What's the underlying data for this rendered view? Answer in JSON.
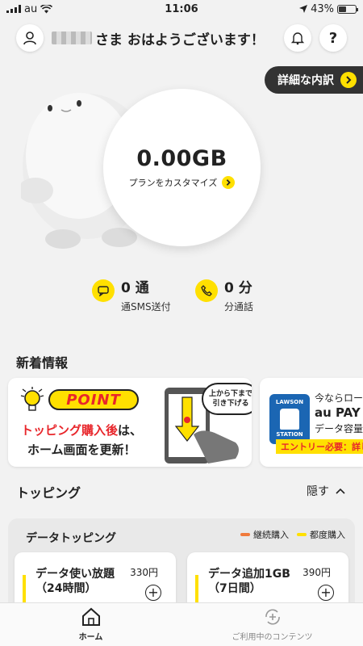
{
  "status_bar": {
    "carrier": "au",
    "time": "11:06",
    "battery": "43%"
  },
  "header": {
    "greeting": "さま おはようございます！",
    "icons": [
      "user-icon",
      "bell-icon",
      "help-icon"
    ],
    "help_label": "?"
  },
  "detail_button": {
    "label": "詳細な内訳"
  },
  "gauge": {
    "value": "0.00GB",
    "link_label": "プランをカスタマイズ"
  },
  "usage": {
    "sms": {
      "value": "0 通",
      "label": "通SMS送付"
    },
    "call": {
      "value": "0 分",
      "label": "分通話"
    }
  },
  "news": {
    "title": "新着情報",
    "card1": {
      "badge": "POINT",
      "line1_red": "トッピング購入後",
      "line1_rest": "は、",
      "line2": "ホーム画面を更新！",
      "bubble_l1": "上から下まで",
      "bubble_l2": "引き下げる"
    },
    "card2": {
      "logo_line1": "LAWSON",
      "logo_line2": "STATION",
      "t1": "今ならロー",
      "t2": "au PAY",
      "t3": "データ容量",
      "tag": "エントリー必要：詳し"
    }
  },
  "topping": {
    "title": "トッピング",
    "toggle_label": "隠す",
    "panel_title": "データトッピング",
    "legend": [
      {
        "label": "継続購入",
        "color": "#f07a3c"
      },
      {
        "label": "都度購入",
        "color": "#ffe000"
      }
    ],
    "cards": [
      {
        "name_line1": "データ使い放題",
        "name_line2": "（24時間）",
        "price": "330円"
      },
      {
        "name_line1": "データ追加1GB",
        "name_line2": "（7日間）",
        "price": "390円"
      }
    ]
  },
  "bottom_nav": {
    "items": [
      {
        "label": "ホーム",
        "active": true
      },
      {
        "label": "ご利用中のコンテンツ",
        "active": false
      }
    ]
  },
  "colors": {
    "accent": "#ffe000",
    "alert_red": "#e8262b",
    "dark": "#333333"
  }
}
